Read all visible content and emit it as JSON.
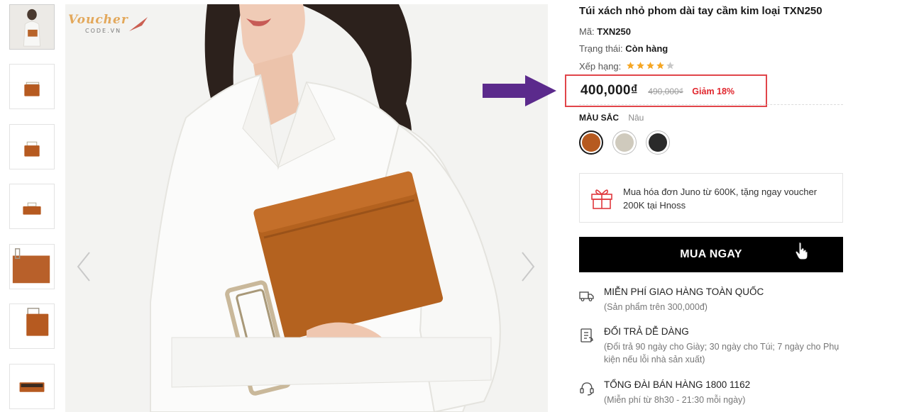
{
  "watermark": {
    "brand": "Voucher",
    "domain": "CODE.VN"
  },
  "gallery": {
    "thumbnail_count": 7,
    "prev_icon": "chevron-left-icon",
    "next_icon": "chevron-right-icon"
  },
  "product": {
    "title": "Túi xách nhỏ phom dài tay cầm kim loại TXN250",
    "code_label": "Mã:",
    "code": "TXN250",
    "status_label": "Trạng thái:",
    "status": "Còn hàng",
    "rating_label": "Xếp hạng:",
    "rating": 4,
    "rating_max": 5,
    "price": "400,000₫",
    "old_price": "490,000₫",
    "discount": "Giảm 18%",
    "color_label": "MÀU SẮC",
    "selected_color": "Nâu",
    "swatches": [
      {
        "name": "Nâu",
        "hex": "#b65a20"
      },
      {
        "name": "Kem",
        "hex": "#cfcabd"
      },
      {
        "name": "Đen",
        "hex": "#2a2a2a"
      }
    ]
  },
  "promo": {
    "icon": "gift-icon",
    "text": "Mua hóa đơn Juno từ 600K, tặng ngay voucher 200K tại Hnoss"
  },
  "buy_button": {
    "label": "MUA NGAY"
  },
  "features": [
    {
      "icon": "truck-icon",
      "title": "MIỄN PHÍ GIAO HÀNG TOÀN QUỐC",
      "sub": "(Sản phẩm trên 300,000đ)"
    },
    {
      "icon": "return-icon",
      "title": "ĐỔI TRẢ DỄ DÀNG",
      "sub": "(Đổi trả 90 ngày cho Giày; 30 ngày cho Túi; 7 ngày cho Phụ kiện nếu lỗi nhà sản xuất)"
    },
    {
      "icon": "headset-icon",
      "title": "TỔNG ĐÀI BÁN HÀNG 1800 1162",
      "sub": "(Miễn phí từ 8h30 - 21:30 mỗi ngày)"
    }
  ],
  "colors": {
    "accent_red": "#e0262d",
    "box_red": "#e1454a",
    "annotation_arrow": "#5b2a8c",
    "star": "#f5a623",
    "star_empty": "#c8c8c8",
    "button_bg": "#000000"
  }
}
